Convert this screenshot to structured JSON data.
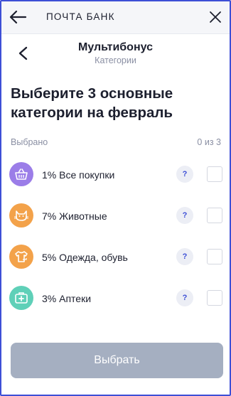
{
  "topbar": {
    "title": "ПОЧТА БАНК",
    "back_icon": "arrow-left-icon",
    "close_icon": "close-icon"
  },
  "header": {
    "title": "Мультибонус",
    "subtitle": "Категории",
    "back_icon": "chevron-left-icon"
  },
  "headline": "Выберите 3 основные категории на февраль",
  "selection": {
    "label": "Выбрано",
    "count": "0 из 3"
  },
  "categories": [
    {
      "label": "1% Все покупки",
      "icon": "basket-icon",
      "color": "#9b7de8",
      "help": "?",
      "checked": false
    },
    {
      "label": "7% Животные",
      "icon": "cat-icon",
      "color": "#f3a24a",
      "help": "?",
      "checked": false
    },
    {
      "label": "5% Одежда, обувь",
      "icon": "clothes-icon",
      "color": "#f3a24a",
      "help": "?",
      "checked": false
    },
    {
      "label": "3% Аптеки",
      "icon": "pharmacy-icon",
      "color": "#5fd0b8",
      "help": "?",
      "checked": false
    }
  ],
  "button": {
    "label": "Выбрать",
    "enabled": false
  },
  "colors": {
    "accent": "#3d4fd6",
    "button_disabled": "#a5afc1",
    "muted_text": "#8a8fa3"
  }
}
